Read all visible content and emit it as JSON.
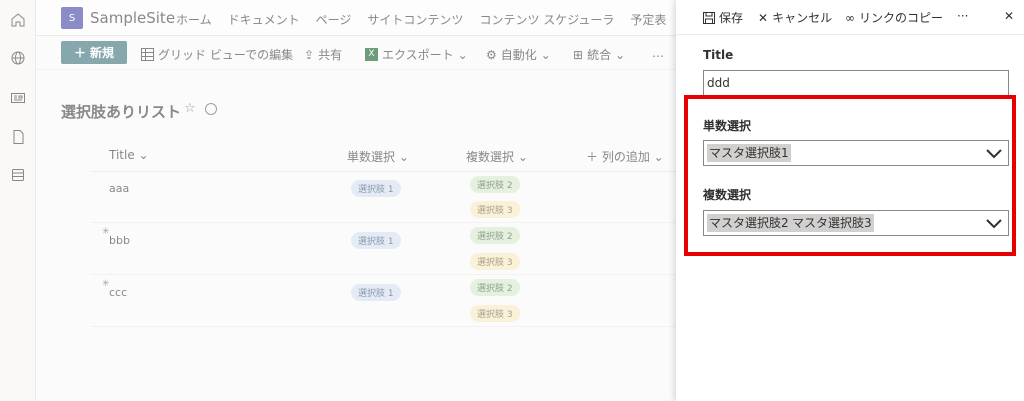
{
  "site": {
    "logo_letter": "S",
    "name": "SampleSite"
  },
  "nav": [
    "ホーム",
    "ドキュメント",
    "ページ",
    "サイトコンテンツ",
    "コンテンツ スケジューラ",
    "予定表"
  ],
  "commands": {
    "new": "新規",
    "grid_edit": "グリッド ビューでの編集",
    "share": "共有",
    "export": "エクスポート",
    "automate": "自動化",
    "integrate": "統合",
    "more": "…"
  },
  "list": {
    "title": "選択肢ありリスト",
    "columns": {
      "title": "Title",
      "single": "単数選択",
      "multi": "複数選択",
      "add_column": "列の追加"
    },
    "rows": [
      {
        "title": "aaa",
        "single": "選択肢 1",
        "multi": [
          "選択肢 2",
          "選択肢 3"
        ]
      },
      {
        "title": "bbb",
        "single": "選択肢 1",
        "multi": [
          "選択肢 2",
          "選択肢 3"
        ]
      },
      {
        "title": "ccc",
        "single": "選択肢 1",
        "multi": [
          "選択肢 2",
          "選択肢 3"
        ]
      }
    ]
  },
  "panel": {
    "save": "保存",
    "cancel": "キャンセル",
    "copy_link": "リンクのコピー",
    "more": "···",
    "title_label": "Title",
    "title_value": "ddd",
    "single_label": "単数選択",
    "single_value": "マスタ選択肢1",
    "multi_label": "複数選択",
    "multi_values": [
      "マスタ選択肢2",
      "マスタ選択肢3"
    ]
  },
  "colors": {
    "highlight": "#e60000",
    "new_button": "#86a7ac"
  }
}
